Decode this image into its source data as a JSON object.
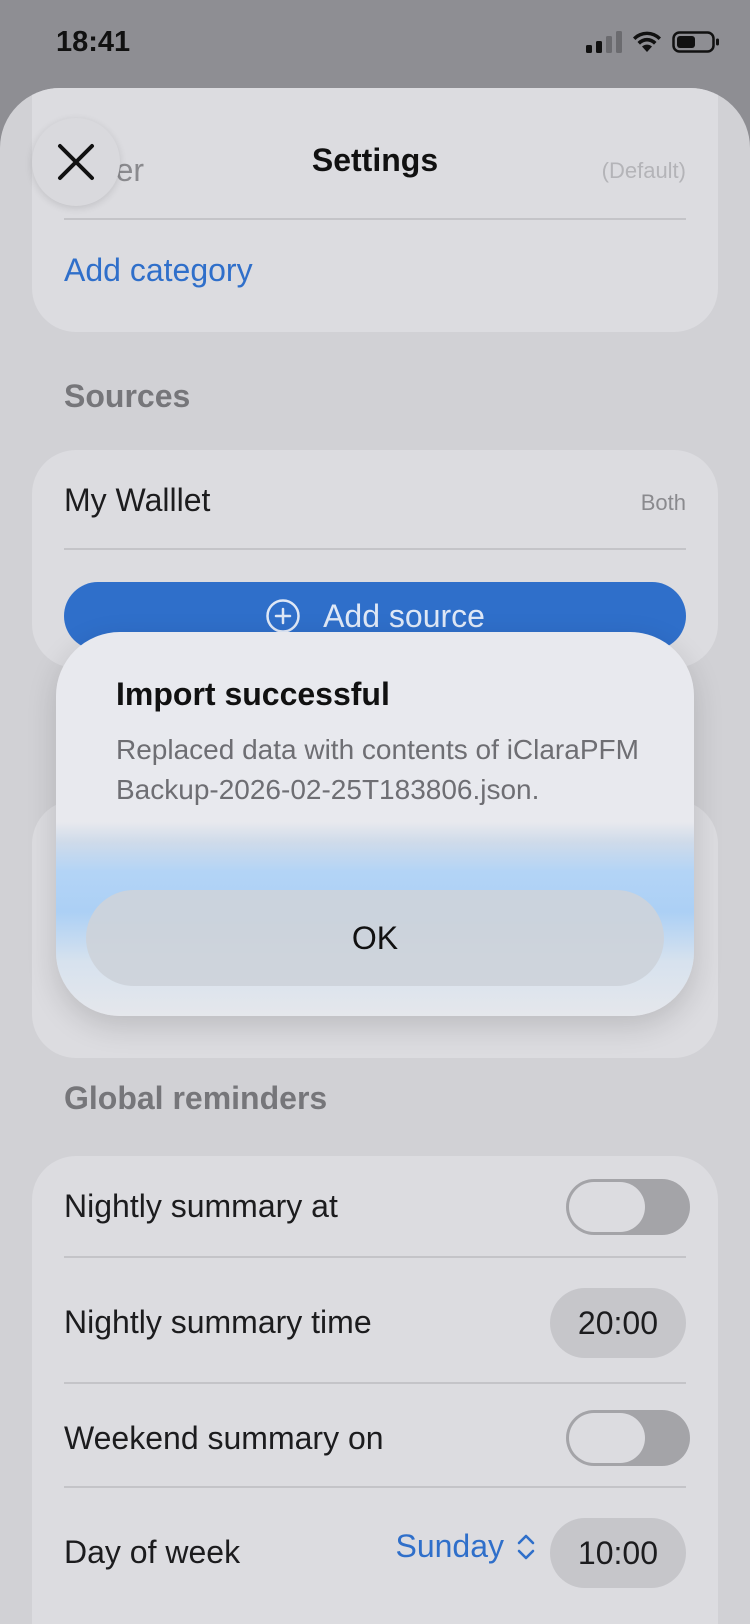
{
  "status_bar": {
    "time": "18:41"
  },
  "header": {
    "title": "Settings"
  },
  "categories": {
    "partial_item_label": "Other",
    "partial_item_value": "(Default)",
    "add_label": "Add category"
  },
  "sources": {
    "header": "Sources",
    "items": [
      {
        "name": "My Walllet",
        "type": "Both"
      }
    ],
    "add_button_label": "Add source"
  },
  "global_reminders": {
    "header": "Global reminders",
    "nightly_summary_label": "Nightly summary at",
    "nightly_time_label": "Nightly summary time",
    "nightly_time_value": "20:00",
    "weekend_summary_label": "Weekend summary on",
    "day_of_week_label": "Day of week",
    "day_of_week_value": "Sunday",
    "weekend_time_value": "10:00"
  },
  "alert": {
    "title": "Import successful",
    "message": "Replaced data with contents of iClaraPFMBackup-2026-02-25T183806.json.",
    "ok_label": "OK"
  },
  "colors": {
    "accent": "#2f6fca",
    "sheet_background": "#d1d1d5",
    "card_background": "#dcdce0"
  }
}
